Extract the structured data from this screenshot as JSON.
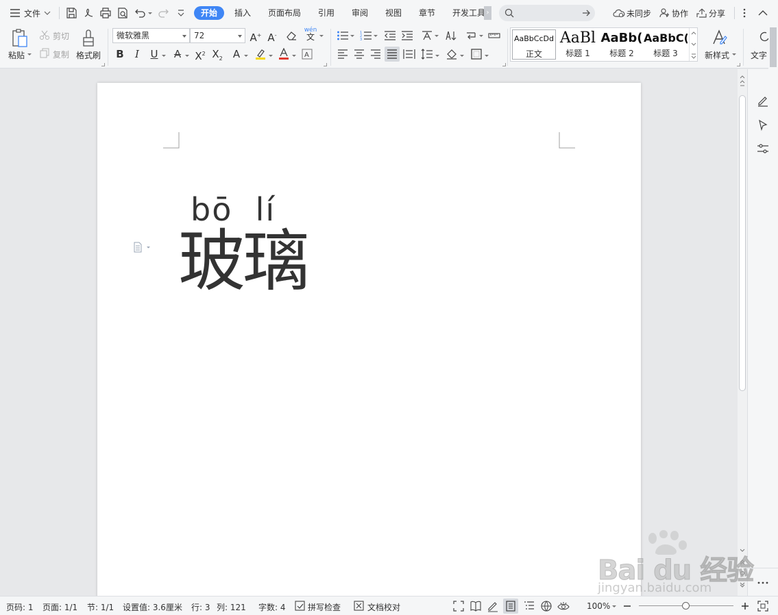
{
  "menubar": {
    "file_label": "文件",
    "tabs": [
      {
        "label": "开始",
        "active": true
      },
      {
        "label": "插入"
      },
      {
        "label": "页面布局"
      },
      {
        "label": "引用"
      },
      {
        "label": "审阅"
      },
      {
        "label": "视图"
      },
      {
        "label": "章节"
      },
      {
        "label": "开发工具"
      }
    ],
    "search_placeholder": "",
    "sync_label": "未同步",
    "collab_label": "协作",
    "share_label": "分享"
  },
  "ribbon": {
    "paste_label": "粘贴",
    "cut_label": "剪切",
    "copy_label": "复制",
    "format_painter_label": "格式刷",
    "font_name": "微软雅黑",
    "font_size": "72",
    "pinyin_guide_icon_text": "wén",
    "styles": [
      {
        "preview": "AaBbCcDd",
        "name": "正文"
      },
      {
        "preview": "AaBl",
        "name": "标题 1"
      },
      {
        "preview": "AaBb(",
        "name": "标题 2"
      },
      {
        "preview": "AaBbC(",
        "name": "标题 3"
      }
    ],
    "new_style_label": "新样式",
    "text_tools_label": "文字"
  },
  "document": {
    "pinyin": "bō  lí",
    "text": "玻璃"
  },
  "statusbar": {
    "page_num": "页码: 1",
    "pages": "页面: 1/1",
    "section": "节: 1/1",
    "setting": "设置值: 3.6厘米",
    "row": "行: 3",
    "col": "列: 121",
    "word_count": "字数: 4",
    "spell_check": "拼写检查",
    "doc_proof": "文档校对",
    "zoom": "100%"
  },
  "watermark": {
    "brand": "Bai du 经验",
    "url": "jingyan.baidu.com"
  },
  "colors": {
    "accent": "#3f86f5",
    "toolbar_bg": "#f5f6f7",
    "workspace_bg": "#e7e8ea",
    "highlight_yellow": "#f5d800",
    "font_color_red": "#e03a2f"
  }
}
